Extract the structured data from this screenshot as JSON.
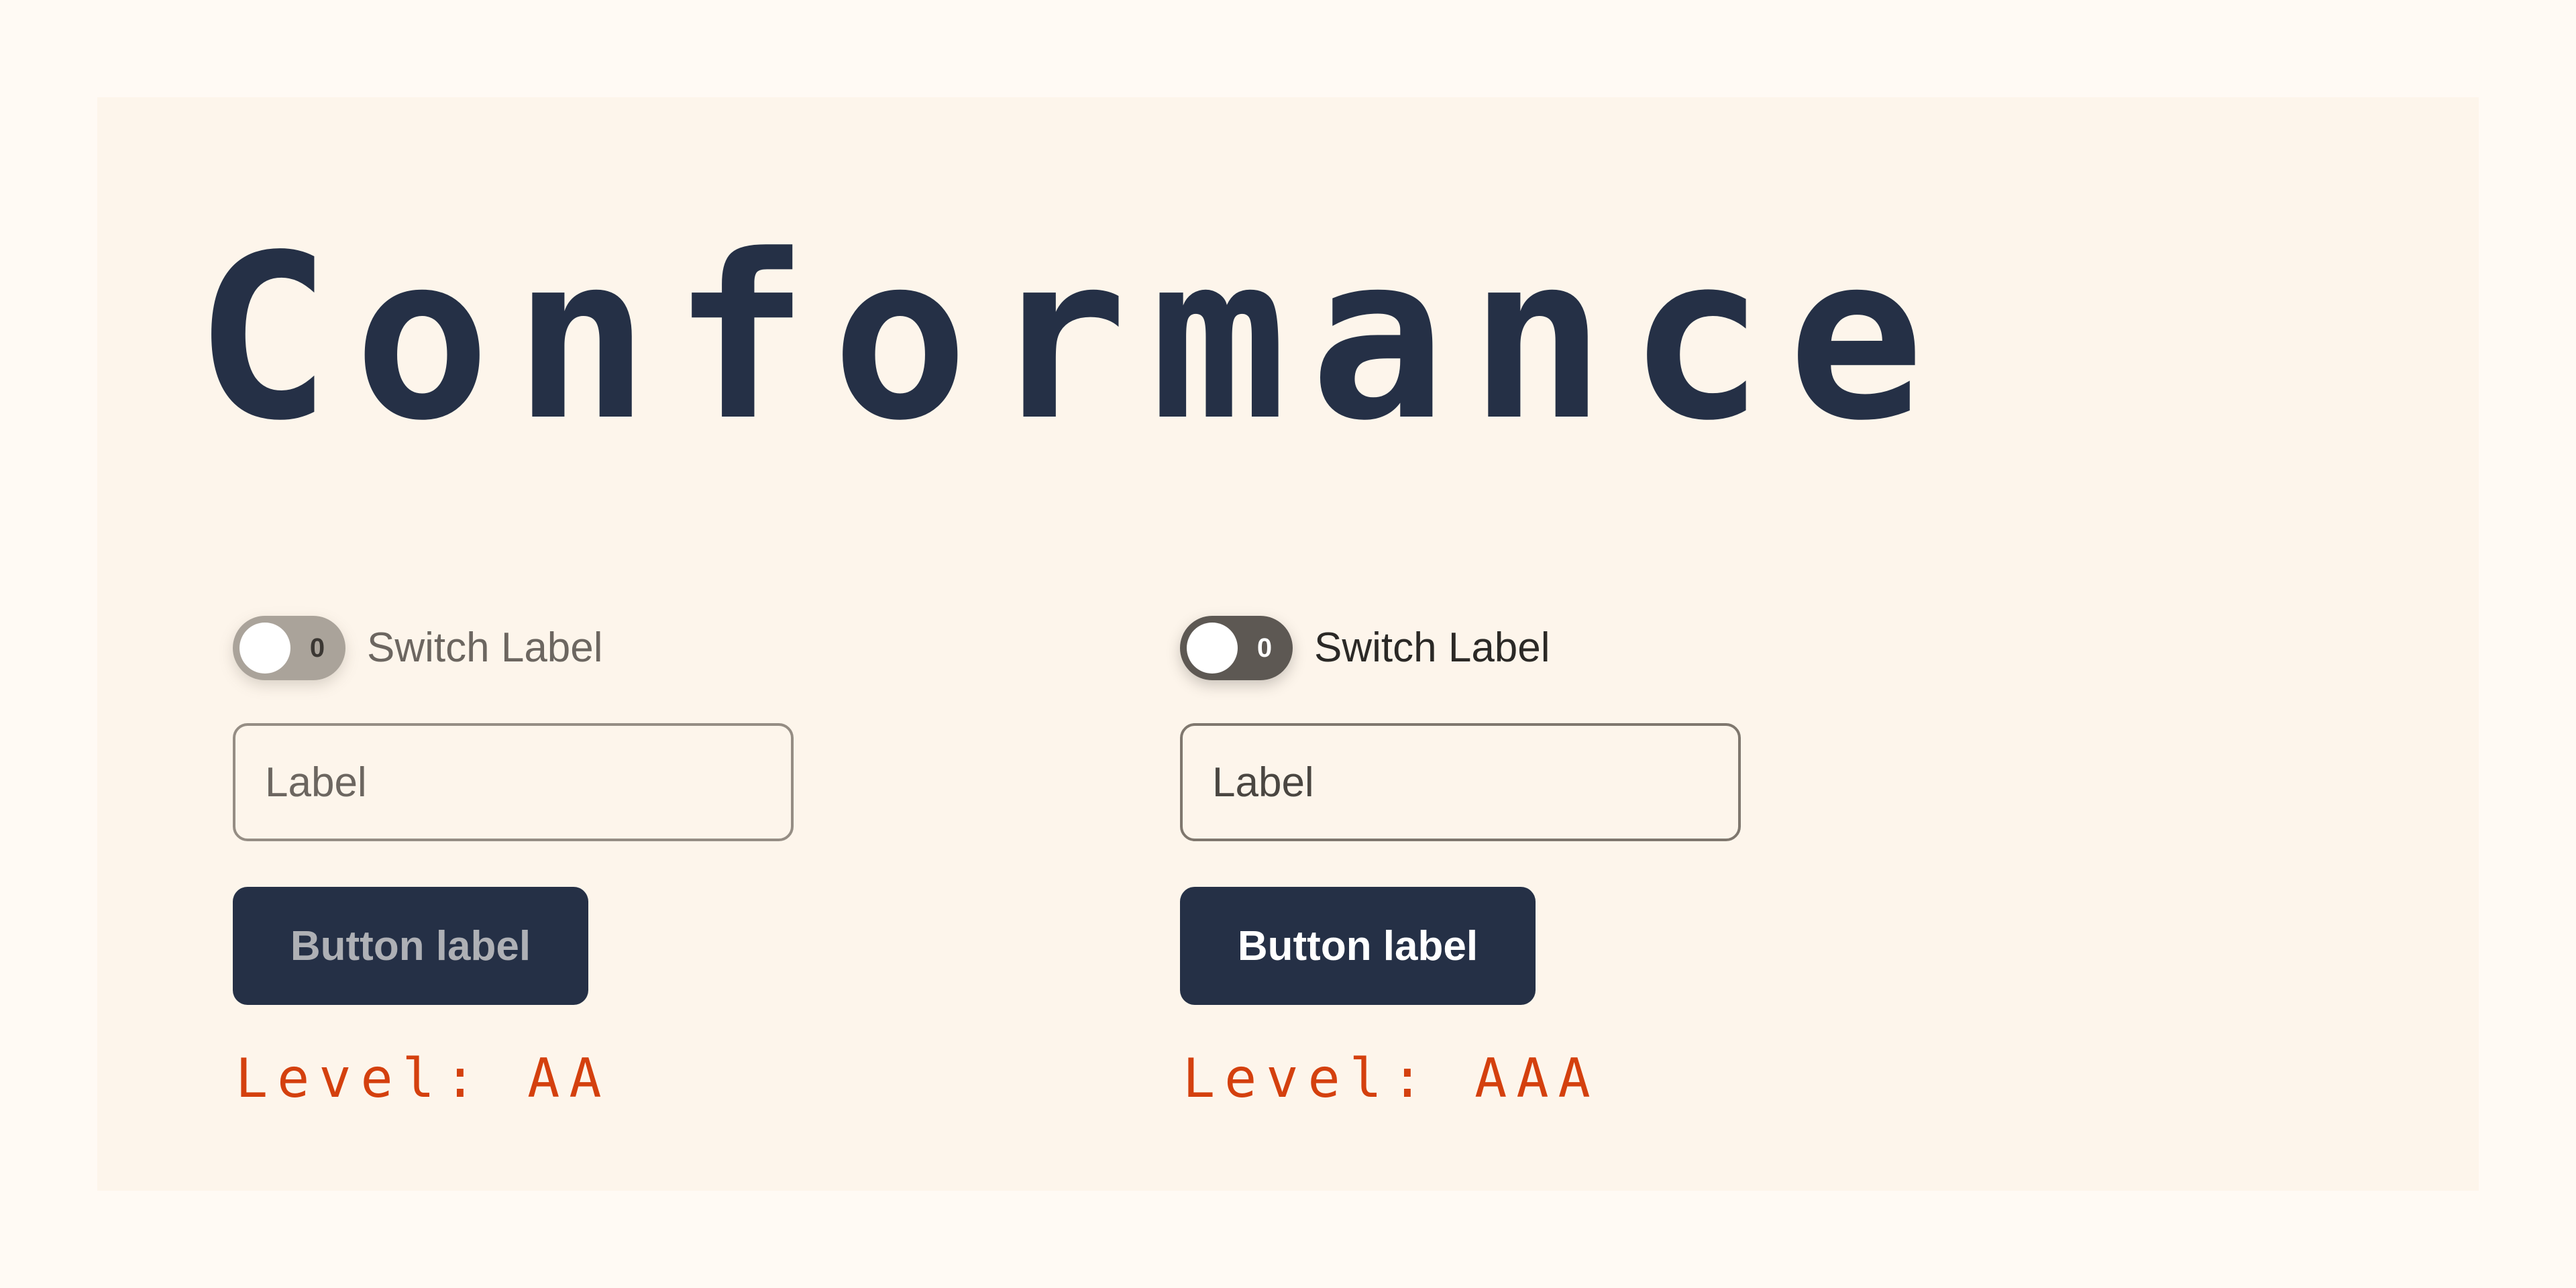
{
  "page": {
    "title": "Conformance"
  },
  "columns": [
    {
      "switch": {
        "value": "0",
        "label": "Switch Label",
        "on": false
      },
      "input": {
        "placeholder": "Label"
      },
      "button": {
        "label": "Button label"
      },
      "level": "Level: AA"
    },
    {
      "switch": {
        "value": "0",
        "label": "Switch Label",
        "on": false
      },
      "input": {
        "placeholder": "Label"
      },
      "button": {
        "label": "Button label"
      },
      "level": "Level: AAA"
    }
  ],
  "colors": {
    "page_background": "#fffaf4",
    "card_background": "#fdf5eb",
    "title": "#253046",
    "button_background": "#253046",
    "level_text": "#d4400e",
    "switch_track_aa": "#aaa39a",
    "switch_track_aaa": "#5d5853"
  }
}
